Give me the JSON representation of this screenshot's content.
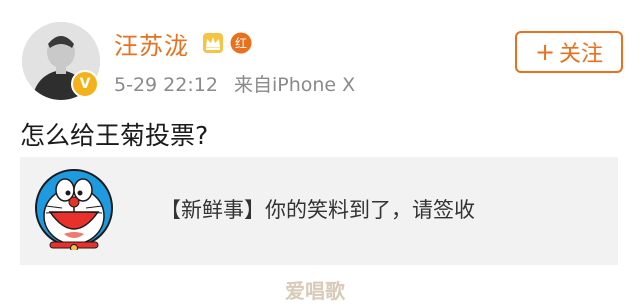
{
  "user": {
    "name": "汪苏泷",
    "verified_badge": "V",
    "red_badge": "红"
  },
  "meta": {
    "time": "5-29 22:12",
    "source": "来自iPhone X"
  },
  "follow": {
    "plus": "+",
    "label": "关注"
  },
  "post": {
    "text": "怎么给王菊投票?"
  },
  "card": {
    "text": "【新鲜事】你的笑料到了，请签收"
  },
  "watermark": "爱唱歌",
  "colors": {
    "accent": "#e9701c",
    "meta": "#8a8a8a",
    "card_bg": "#f2f2f2"
  }
}
